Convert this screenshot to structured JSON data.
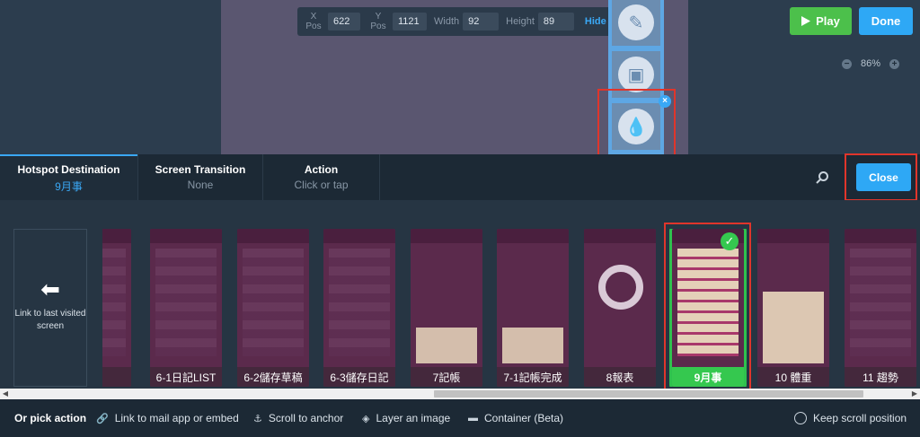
{
  "coords": {
    "x_label": [
      "X",
      "Pos"
    ],
    "x_value": "622",
    "y_label": [
      "Y",
      "Pos"
    ],
    "y_value": "1121",
    "width_label": "Width",
    "width_value": "92",
    "height_label": "Height",
    "height_value": "89",
    "hide_label": "Hide"
  },
  "toolbar": {
    "play_label": "Play",
    "done_label": "Done",
    "zoom_value": "86%"
  },
  "tabs": [
    {
      "title": "Hotspot Destination",
      "value": "9月事"
    },
    {
      "title": "Screen Transition",
      "value": "None"
    },
    {
      "title": "Action",
      "value": "Click or tap"
    }
  ],
  "close_label": "Close",
  "link_last_label": "Link to last visited screen",
  "screens": [
    {
      "label": "記"
    },
    {
      "label": "6-1日記LIST"
    },
    {
      "label": "6-2儲存草稿"
    },
    {
      "label": "6-3儲存日記"
    },
    {
      "label": "7記帳"
    },
    {
      "label": "7-1記帳完成"
    },
    {
      "label": "8報表"
    },
    {
      "label": "9月事"
    },
    {
      "label": "10 體重"
    },
    {
      "label": "11 趨勢"
    }
  ],
  "actions": {
    "title": "Or pick action",
    "items": [
      "Link to mail app or embed",
      "Scroll to anchor",
      "Layer an image",
      "Container (Beta)"
    ],
    "keep_scroll": "Keep scroll position"
  },
  "colors": {
    "accent": "#2ea8f5",
    "play": "#4cc04b",
    "selected": "#35c84f",
    "highlight": "#e0352b"
  }
}
